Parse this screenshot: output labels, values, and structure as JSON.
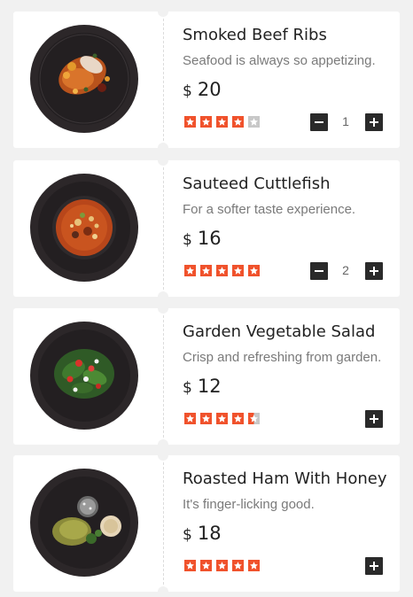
{
  "menu": {
    "items": [
      {
        "name": "Smoked Beef Ribs",
        "description": "Seafood is always so appetizing.",
        "currency": "$",
        "price": "20",
        "rating": 4,
        "quantity": "1",
        "show_quantity": true,
        "dish": "ribs"
      },
      {
        "name": "Sauteed Cuttlefish",
        "description": "For a softer taste experience.",
        "currency": "$",
        "price": "16",
        "rating": 5,
        "quantity": "2",
        "show_quantity": true,
        "dish": "soup"
      },
      {
        "name": "Garden Vegetable Salad",
        "description": "Crisp and refreshing from garden.",
        "currency": "$",
        "price": "12",
        "rating": 4.5,
        "quantity": "0",
        "show_quantity": false,
        "dish": "salad"
      },
      {
        "name": "Roasted Ham With Honey",
        "description": "It's finger-licking good.",
        "currency": "$",
        "price": "18",
        "rating": 5,
        "quantity": "0",
        "show_quantity": false,
        "dish": "ham"
      }
    ]
  },
  "colors": {
    "star_filled": "#f0522c",
    "star_empty": "#c8c8c8",
    "stepper_button": "#2a2a2a",
    "page_background": "#f1f1f1"
  },
  "icons": {
    "minus": "minus-icon",
    "plus": "plus-icon",
    "star": "star-icon"
  }
}
